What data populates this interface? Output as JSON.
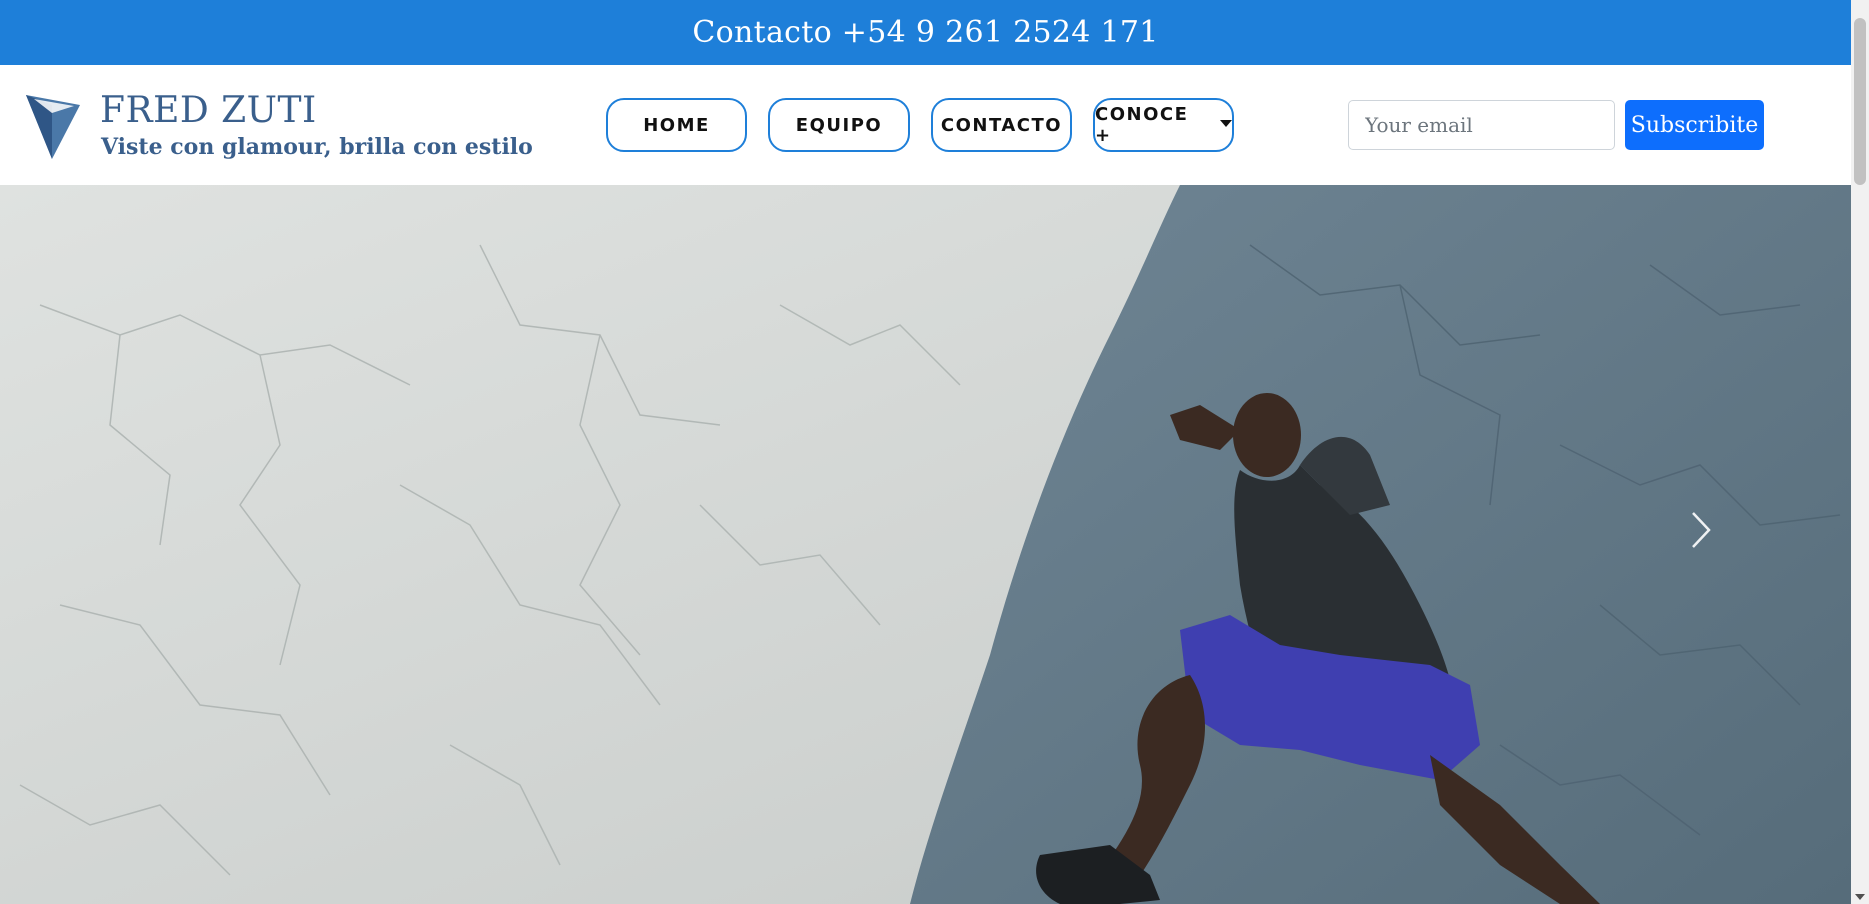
{
  "topbar": {
    "contact_text": "Contacto +54 9 261 2524 171"
  },
  "brand": {
    "name": "FRED ZUTI",
    "tagline": "Viste con glamour, brilla con estilo",
    "color": "#3a5f8c"
  },
  "nav": {
    "items": [
      {
        "label": "HOME"
      },
      {
        "label": "EQUIPO"
      },
      {
        "label": "CONTACTO"
      },
      {
        "label": "CONOCE +"
      }
    ]
  },
  "subscribe": {
    "email_placeholder": "Your email",
    "button_label": "Subscribite"
  },
  "hero": {
    "image_subject": "runner-on-cracked-concrete",
    "next_icon": "chevron-right-icon"
  },
  "colors": {
    "accent": "#1e7fd9",
    "button": "#0d6efd"
  }
}
